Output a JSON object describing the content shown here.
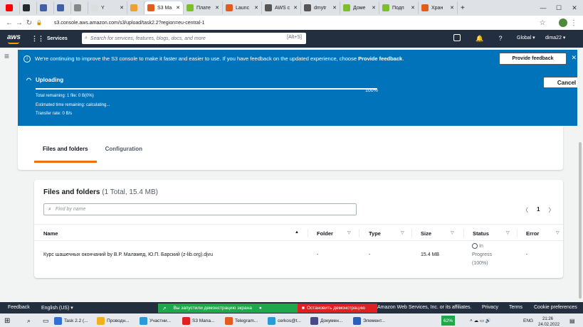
{
  "browser": {
    "tabs": [
      {
        "label": "",
        "color": "#ff0000"
      },
      {
        "label": "",
        "color": "#24292e"
      },
      {
        "label": "",
        "color": "#3f5fa8"
      },
      {
        "label": "",
        "color": "#3f5fa8"
      },
      {
        "label": "",
        "color": "#888888"
      },
      {
        "label": "Y",
        "color": "#dddddd"
      },
      {
        "label": "",
        "color": "#f0a030"
      },
      {
        "label": "S3 Ма",
        "color": "#e25c1c",
        "active": true
      },
      {
        "label": "Плате",
        "color": "#7bbf2c"
      },
      {
        "label": "Launc",
        "color": "#e25c1c"
      },
      {
        "label": "AWS c",
        "color": "#555555"
      },
      {
        "label": "dmytr",
        "color": "#555555"
      },
      {
        "label": "Доме",
        "color": "#7bbf2c"
      },
      {
        "label": "Подп",
        "color": "#7bbf2c"
      },
      {
        "label": "Хран",
        "color": "#e25c1c"
      }
    ],
    "new_tab": "+",
    "url": "s3.console.aws.amazon.com/s3/upload/task2.2?region=eu-central-1"
  },
  "aws_header": {
    "logo": "aws",
    "services": "Services",
    "search_placeholder": "Search for services, features, blogs, docs, and more",
    "search_shortcut": "[Alt+S]",
    "region": "Global ▾",
    "user": "dima22 ▾"
  },
  "banner": {
    "text_pre": "We're continuing to improve the S3 console to make it faster and easier to use. If you have feedback on the updated experience, choose ",
    "text_bold": "Provide feedback",
    "text_post": ".",
    "button": "Provide feedback",
    "close": "✕"
  },
  "upload": {
    "title": "Uploading",
    "progress": 1.0,
    "percent": "100%",
    "line1": "Total remaining: 1 file: 0 B(0%)",
    "line2": "Estimated time remaining: calculating...",
    "line3": "Transfer rate: 0 B/s",
    "cancel": "Cancel"
  },
  "tabs": [
    {
      "label": "Files and folders",
      "active": true
    },
    {
      "label": "Configuration",
      "active": false
    }
  ],
  "files": {
    "title": "Files and folders",
    "count": "(1 Total, 15.4 MB)",
    "find_placeholder": "Find by name",
    "page": "1",
    "prev": "〈",
    "next": "〉",
    "columns": [
      "Name",
      "Folder",
      "Type",
      "Size",
      "Status",
      "Error"
    ],
    "rows": [
      {
        "name": "Курс шашечных окончаний by В.Р. Маламед, Ю.П. Барский (z-lib.org).djvu",
        "folder": "-",
        "type": "-",
        "size": "15.4 MB",
        "status_line1": "In",
        "status_line2": "Progress",
        "status_line3": "(100%)",
        "error": "-"
      }
    ]
  },
  "footer": {
    "feedback": "Feedback",
    "language": "English (US) ▾",
    "copyright": "Amazon Web Services, Inc. or its affiliates.",
    "privacy": "Privacy",
    "terms": "Terms",
    "cookies": "Cookie preferences"
  },
  "demo": {
    "running": "Вы запустили демонстрацию экрана",
    "stop": "Остановить демонстрацию"
  },
  "taskbar": {
    "items": [
      "Task 2.2 (...",
      "Проводн...",
      "Участни...",
      "S3 Mana...",
      "Telegram...",
      "cerkos@t...",
      "Докумен...",
      "Элемент..."
    ],
    "battery": "62%",
    "lang": "ENG",
    "time": "21:26",
    "date": "24.02.2022"
  }
}
